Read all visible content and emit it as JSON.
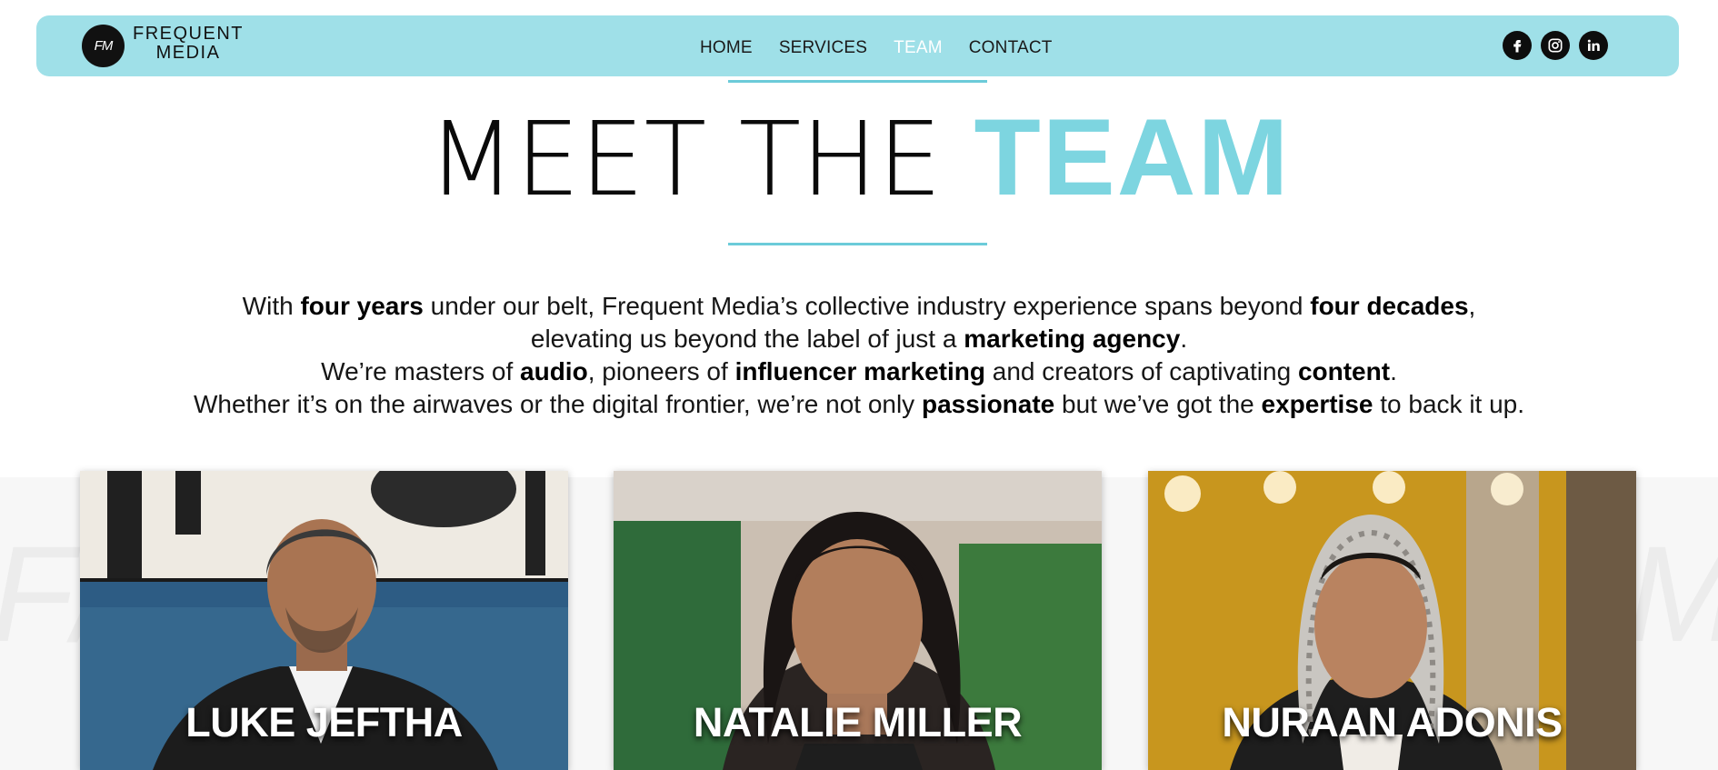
{
  "header": {
    "logo_mark": "FM",
    "logo_line1": "FREQUENT",
    "logo_line2": "MEDIA",
    "nav": [
      {
        "label": "HOME"
      },
      {
        "label": "SERVICES"
      },
      {
        "label": "TEAM"
      },
      {
        "label": "CONTACT"
      }
    ],
    "social": [
      "facebook-icon",
      "instagram-icon",
      "linkedin-icon"
    ]
  },
  "hero": {
    "title_light": "MEET THE",
    "title_accent": "TEAM"
  },
  "intro": {
    "line1_a": "With ",
    "line1_b": "four years",
    "line1_c": " under our belt, Frequent Media’s collective industry experience spans beyond ",
    "line1_d": "four decades",
    "line1_e": ",",
    "line2_a": "elevating us beyond the label of just a ",
    "line2_b": "marketing agency",
    "line2_c": ".",
    "line3_a": "We’re masters of ",
    "line3_b": "audio",
    "line3_c": ", pioneers of ",
    "line3_d": "influencer marketing",
    "line3_e": " and creators of captivating ",
    "line3_f": "content",
    "line3_g": ".",
    "line4_a": "Whether it’s on the airwaves or the digital frontier, we’re not only ",
    "line4_b": "passionate",
    "line4_c": " but we’ve got the ",
    "line4_d": "expertise",
    "line4_e": " to back it up."
  },
  "team": [
    {
      "name": "LUKE JEFTHA"
    },
    {
      "name": "NATALIE MILLER"
    },
    {
      "name": "NURAAN ADONIS"
    }
  ],
  "colors": {
    "header_bg": "#9fe0e8",
    "accent": "#7dd5e0",
    "rule": "#6ccbd9"
  }
}
